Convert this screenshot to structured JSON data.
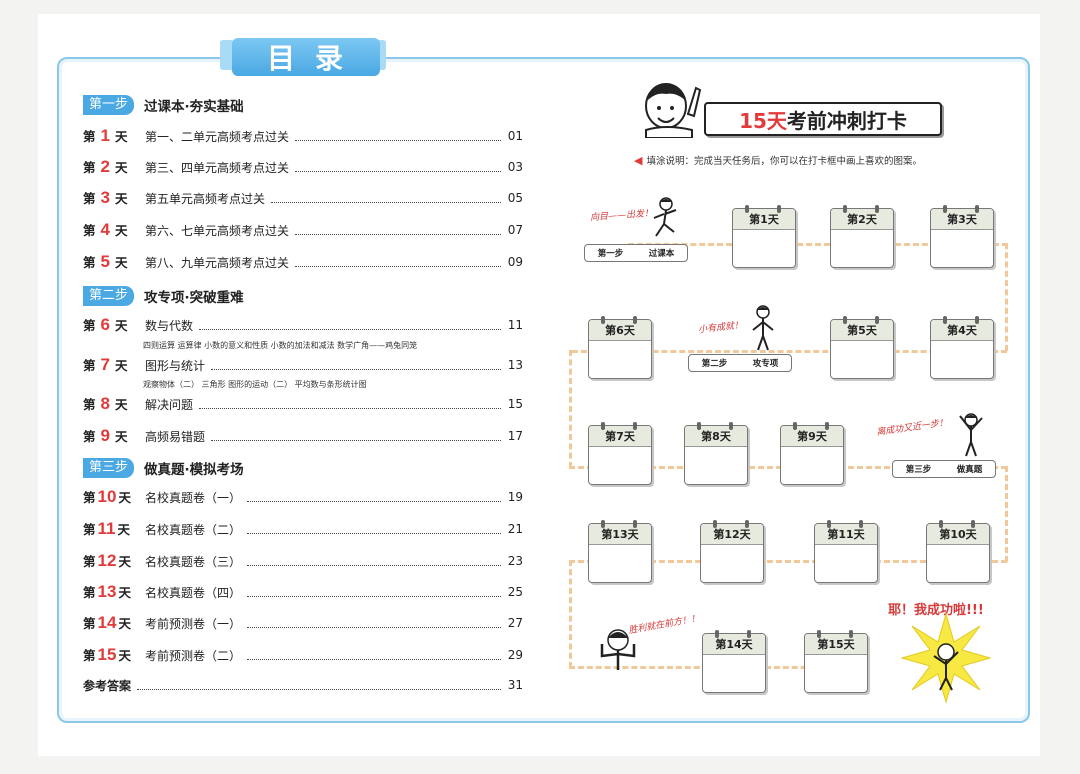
{
  "header": {
    "tab_title": "目录"
  },
  "toc": {
    "sections": [
      {
        "badge": "第一步",
        "title": "过课本·夯实基础"
      },
      {
        "badge": "第二步",
        "title": "攻专项·突破重难"
      },
      {
        "badge": "第三步",
        "title": "做真题·模拟考场"
      }
    ],
    "day_prefix": "第",
    "day_suffix": "天",
    "entries": [
      {
        "day": "1",
        "title": "第一、二单元高频考点过关",
        "page": "01"
      },
      {
        "day": "2",
        "title": "第三、四单元高频考点过关",
        "page": "03"
      },
      {
        "day": "3",
        "title": "第五单元高频考点过关",
        "page": "05"
      },
      {
        "day": "4",
        "title": "第六、七单元高频考点过关",
        "page": "07"
      },
      {
        "day": "5",
        "title": "第八、九单元高频考点过关",
        "page": "09"
      },
      {
        "day": "6",
        "title": "数与代数",
        "page": "11"
      },
      {
        "day": "7",
        "title": "图形与统计",
        "page": "13"
      },
      {
        "day": "8",
        "title": "解决问题",
        "page": "15"
      },
      {
        "day": "9",
        "title": "高频易错题",
        "page": "17"
      },
      {
        "day": "10",
        "title": "名校真题卷（一）",
        "page": "19"
      },
      {
        "day": "11",
        "title": "名校真题卷（二）",
        "page": "21"
      },
      {
        "day": "12",
        "title": "名校真题卷（三）",
        "page": "23"
      },
      {
        "day": "13",
        "title": "名校真题卷（四）",
        "page": "25"
      },
      {
        "day": "14",
        "title": "考前预测卷（一）",
        "page": "27"
      },
      {
        "day": "15",
        "title": "考前预测卷（二）",
        "page": "29"
      }
    ],
    "sub_lines": {
      "day6": "四则运算  运算律  小数的意义和性质  小数的加法和减法  数学广角——鸡兔同笼",
      "day7": "观察物体（二）  三角形  图形的运动（二）  平均数与条形统计图"
    },
    "answers": {
      "title": "参考答案",
      "page": "31"
    }
  },
  "checkin": {
    "title_highlight": "15天",
    "title_rest": "考前冲刺打卡",
    "instruction": "填涂说明：完成当天任务后，你可以在打卡框中画上喜欢的图案。",
    "days": [
      "第1天",
      "第2天",
      "第3天",
      "第4天",
      "第5天",
      "第6天",
      "第7天",
      "第8天",
      "第9天",
      "第10天",
      "第11天",
      "第12天",
      "第13天",
      "第14天",
      "第15天"
    ],
    "steps": [
      {
        "step": "第一步",
        "name": "过课本"
      },
      {
        "step": "第二步",
        "name": "攻专项"
      },
      {
        "step": "第三步",
        "name": "做真题"
      }
    ],
    "notes": {
      "start": "向目——出发！",
      "step2": "小有成就！",
      "step3": "离成功又近一步！",
      "final": "胜利就在前方！！",
      "finish": "耶！我成功啦!!!"
    }
  }
}
